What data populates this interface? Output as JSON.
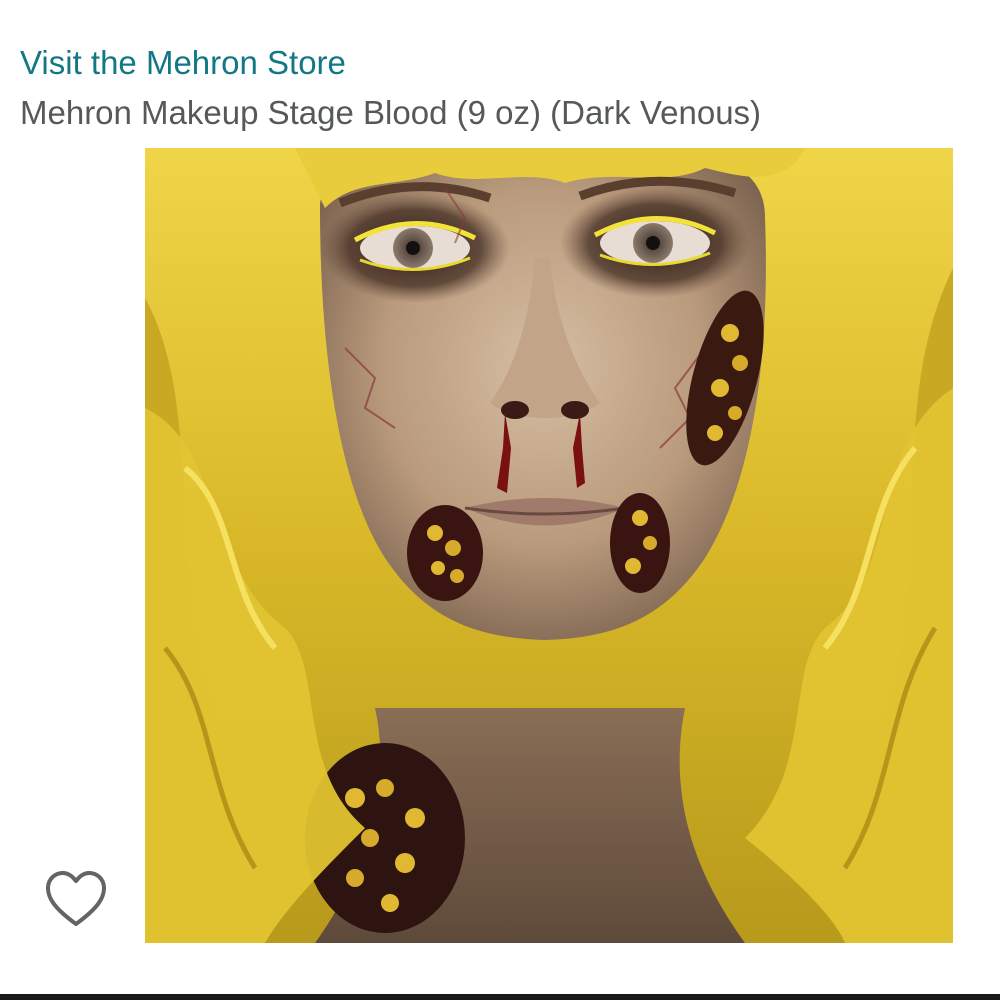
{
  "header": {
    "store_link": "Visit the Mehron Store",
    "product_title": "Mehron Makeup Stage Blood (9 oz) (Dark Venous)"
  },
  "image": {
    "subject": "zombie makeup model with yellow wig",
    "colors": {
      "hair": "#e2c332",
      "skin": "#c8ab8c",
      "blood": "#7a1010"
    }
  },
  "actions": {
    "wishlist_icon": "heart-outline-icon"
  }
}
